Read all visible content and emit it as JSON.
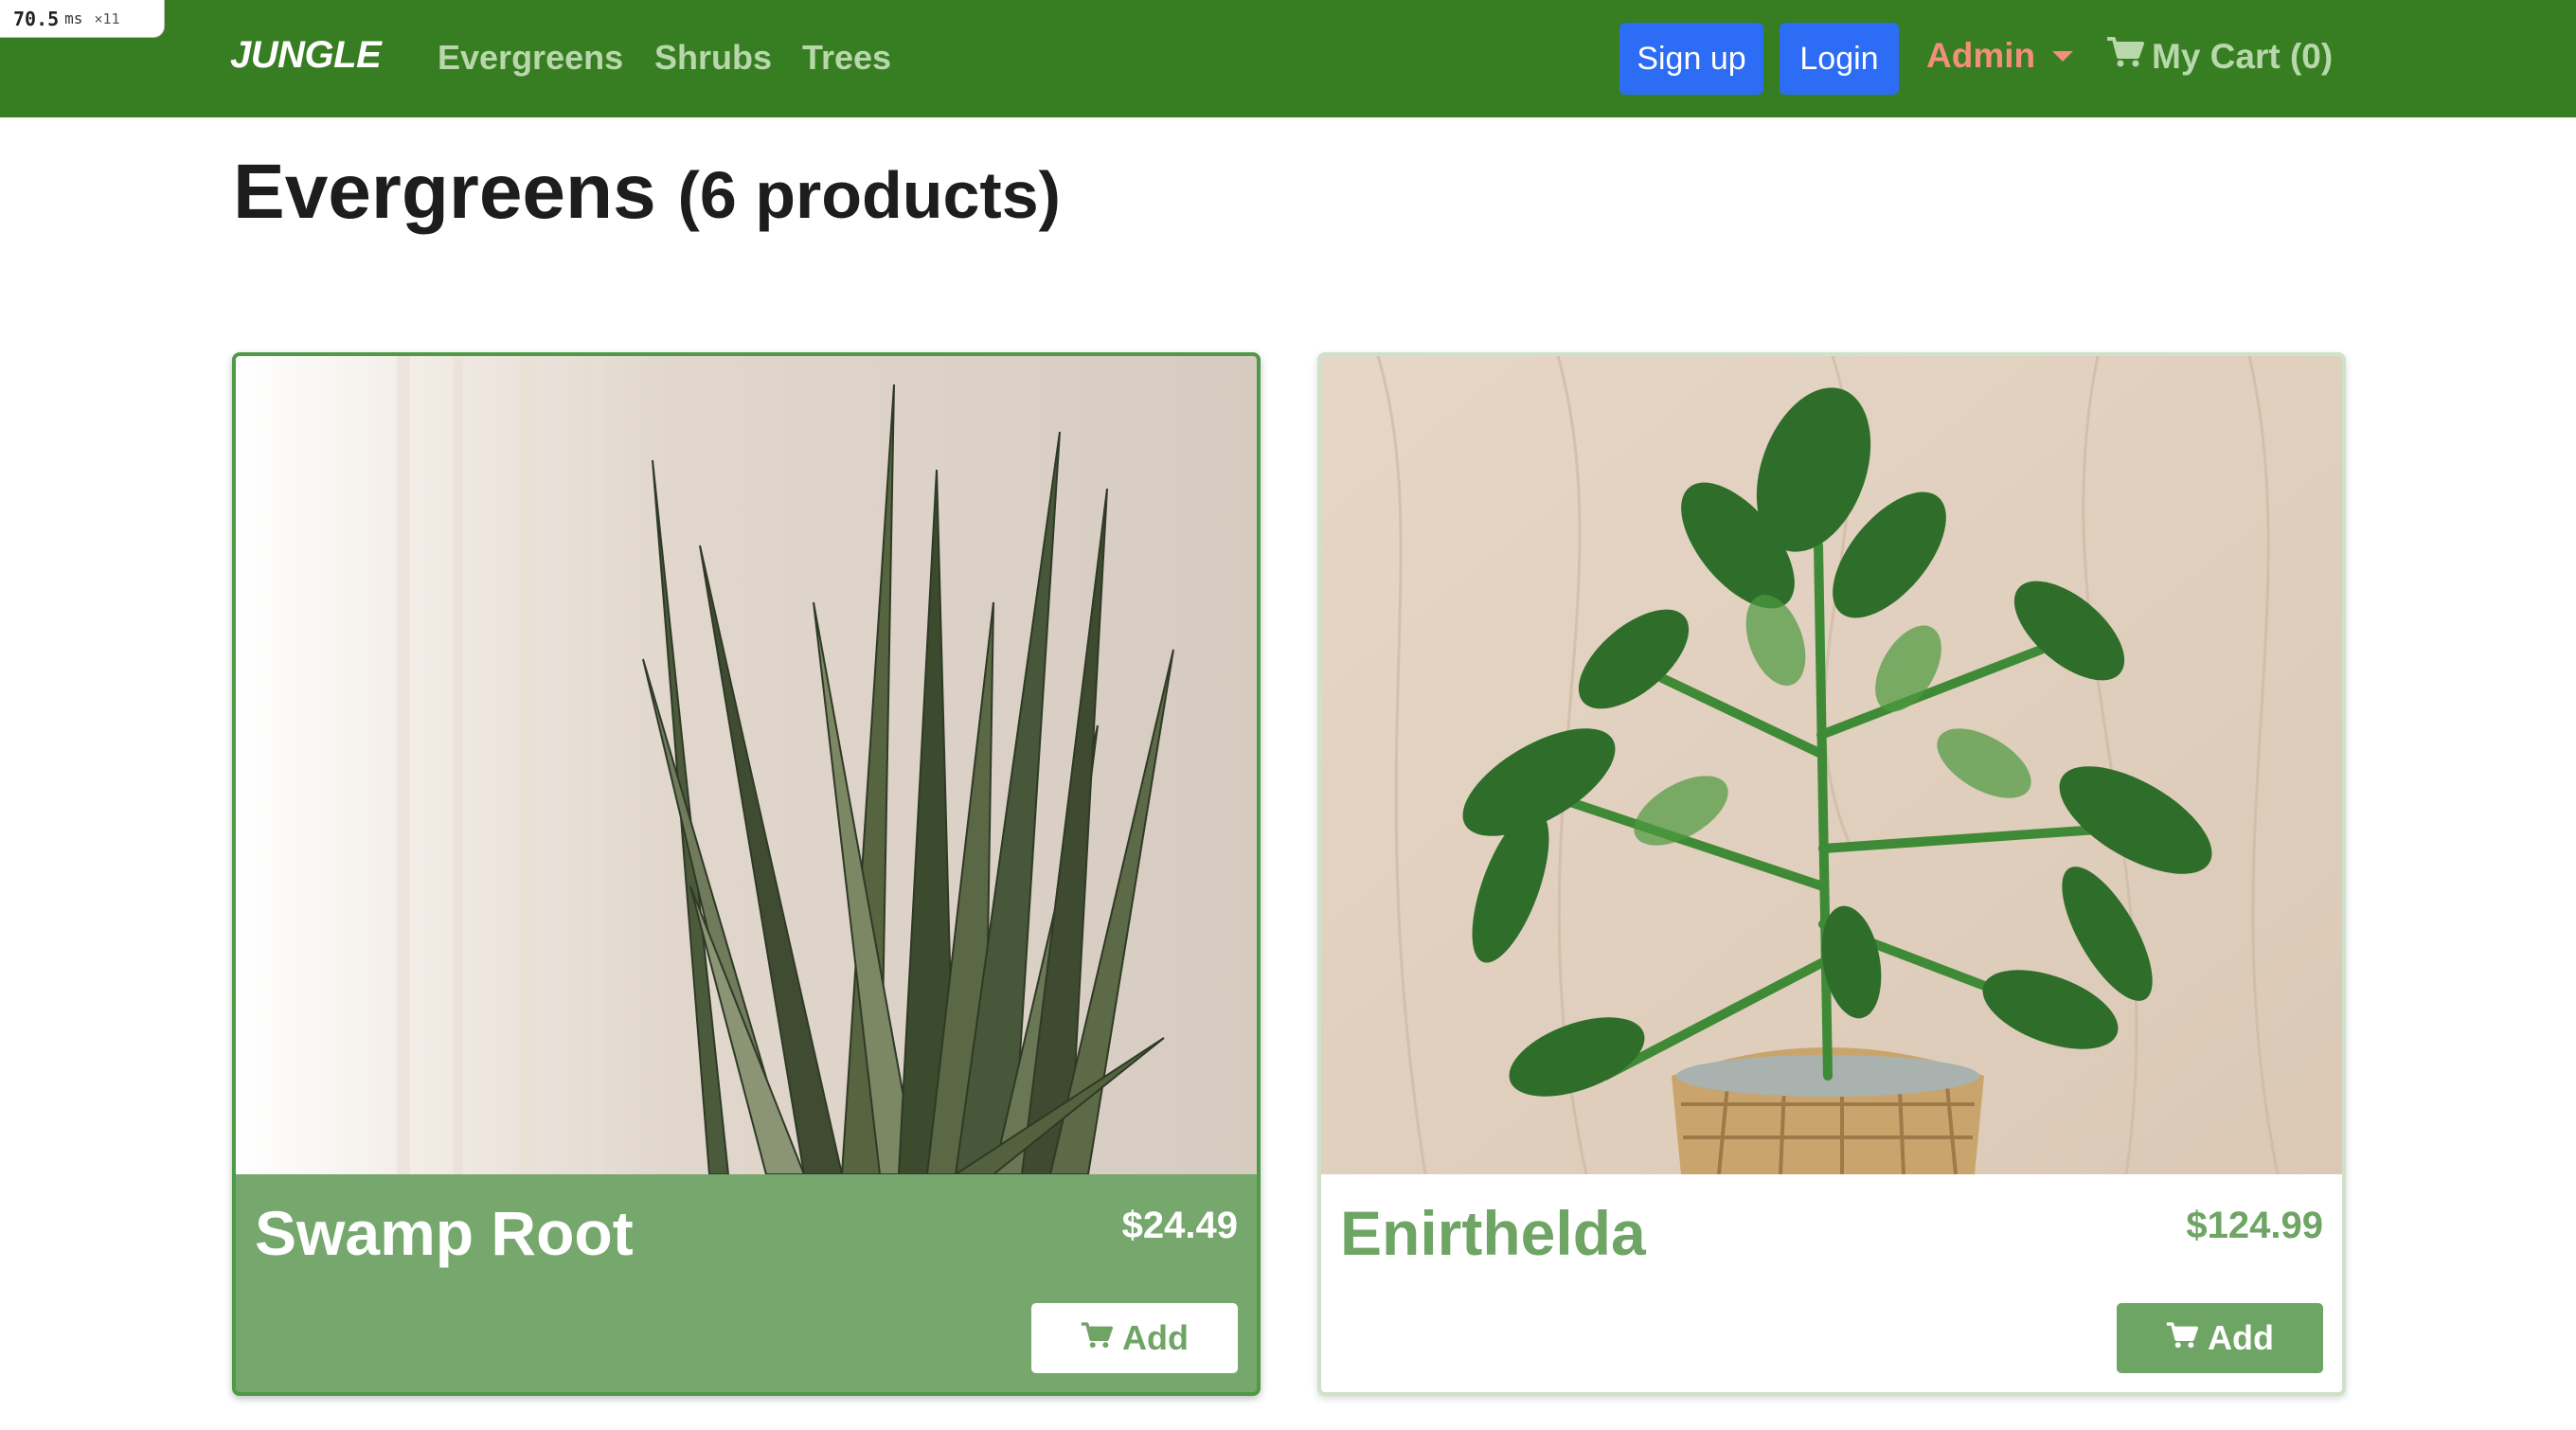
{
  "perf_badge": {
    "value": "70.5",
    "unit": "ms",
    "multiplier": "×11"
  },
  "navbar": {
    "brand": "JUNGLE",
    "links": [
      "Evergreens",
      "Shrubs",
      "Trees"
    ],
    "signup_label": "Sign up",
    "login_label": "Login",
    "admin_label": "Admin",
    "cart_label": "My Cart (0)",
    "icons": {
      "cart": "cart-icon",
      "admin_caret": "chevron-down-icon"
    }
  },
  "page": {
    "title": "Evergreens",
    "count": "(6 products)"
  },
  "products": [
    {
      "name": "Swamp Root",
      "price": "$24.49",
      "add_label": "Add",
      "image": "snake-plant-photo"
    },
    {
      "name": "Enirthelda",
      "price": "$124.99",
      "add_label": "Add",
      "image": "potted-green-plant-photo"
    }
  ],
  "colors": {
    "navbar_bg": "#377d22",
    "nav_link": "#b8d8ac",
    "admin": "#f0907a",
    "button_blue": "#2d6cf5",
    "card_green": "#76a76d",
    "accent_green": "#6ea464"
  }
}
